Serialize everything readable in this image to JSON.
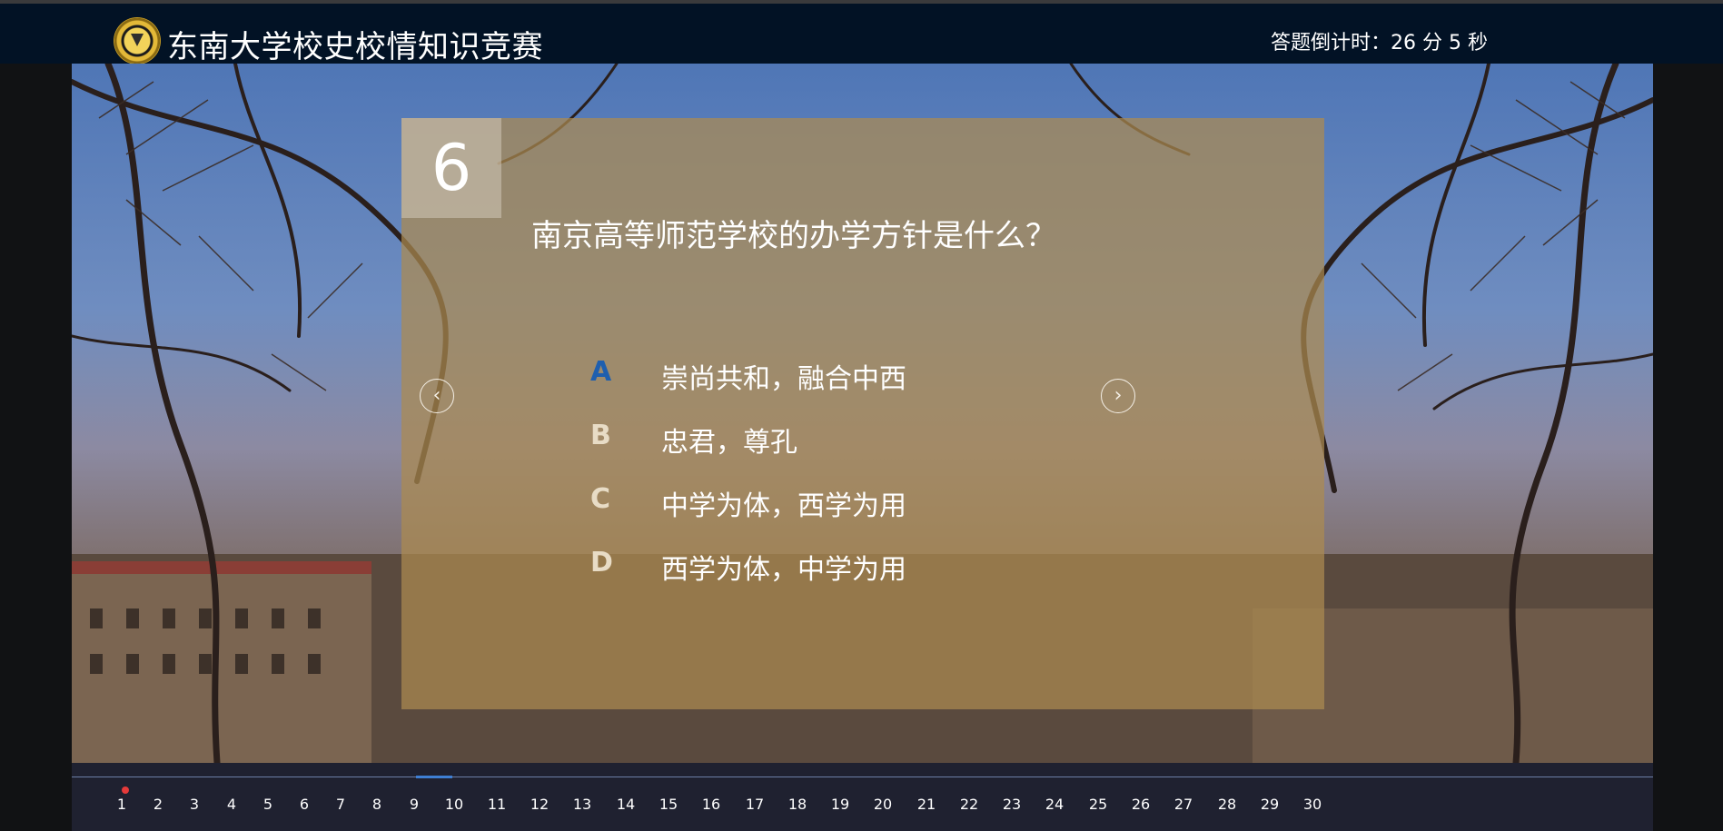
{
  "header": {
    "title": "东南大学校史校情知识竞赛",
    "timer_label": "答题倒计时：",
    "minutes": "26",
    "minutes_unit": "分",
    "seconds": "5",
    "seconds_unit": "秒",
    "logo_icon": "university-seal-icon"
  },
  "question": {
    "number": "6",
    "text": "南京高等师范学校的办学方针是什么？",
    "options": [
      {
        "letter": "A",
        "text": "崇尚共和，融合中西",
        "selected": true
      },
      {
        "letter": "B",
        "text": "忠君，尊孔",
        "selected": false
      },
      {
        "letter": "C",
        "text": "中学为体，西学为用",
        "selected": false
      },
      {
        "letter": "D",
        "text": "西学为体，中学为用",
        "selected": false
      }
    ]
  },
  "nav": {
    "prev_icon": "chevron-left-icon",
    "next_icon": "chevron-right-icon"
  },
  "pager": {
    "pages": [
      "1",
      "2",
      "3",
      "4",
      "5",
      "6",
      "7",
      "8",
      "9",
      "10",
      "11",
      "12",
      "13",
      "14",
      "15",
      "16",
      "17",
      "18",
      "19",
      "20",
      "21",
      "22",
      "23",
      "24",
      "25",
      "26",
      "27",
      "28",
      "29",
      "30"
    ],
    "current": "6",
    "marked": [
      "1"
    ]
  },
  "colors": {
    "header_bg": "#021225",
    "panel_bg": "#ac8a50",
    "selected_letter": "#1f5fae",
    "active_indicator": "#3e7fd4",
    "marker_dot": "#e53a3a"
  }
}
